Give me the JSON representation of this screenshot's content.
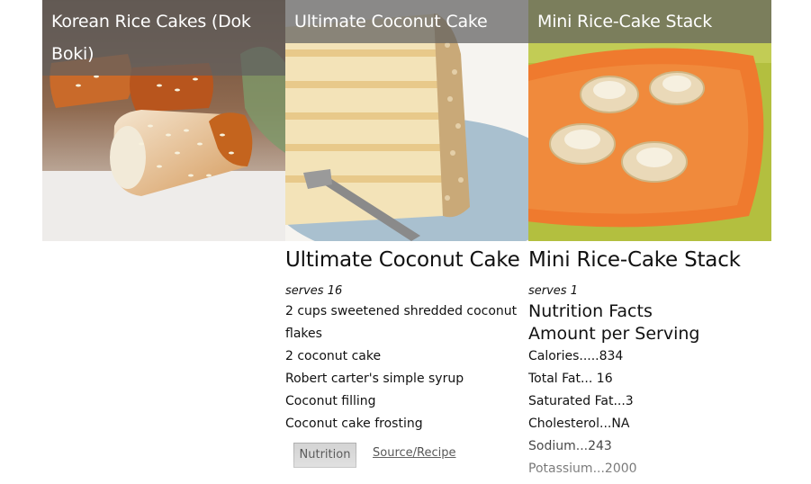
{
  "cards": [
    {
      "overlay_title": "Korean Rice Cakes (Dok Boki)"
    },
    {
      "overlay_title": "Ultimate Coconut Cake",
      "title": "Ultimate Coconut Cake",
      "serves": "serves 16",
      "ingredients": [
        "2 cups sweetened shredded coconut flakes",
        "2 coconut cake",
        "Robert carter's simple syrup",
        "Coconut filling",
        "Coconut cake frosting"
      ],
      "nutrition_button": "Nutrition",
      "source_link": "Source/Recipe"
    },
    {
      "overlay_title": "Mini Rice-Cake Stack",
      "title": "Mini Rice-Cake Stack",
      "serves": "serves 1",
      "nutrition_heading_1": "Nutrition Facts",
      "nutrition_heading_2": "Amount per Serving",
      "facts": [
        "Calories.....834",
        "Total Fat... 16",
        "Saturated Fat...3",
        "Cholesterol...NA",
        "Sodium...243",
        "Potassium...2000"
      ]
    }
  ]
}
